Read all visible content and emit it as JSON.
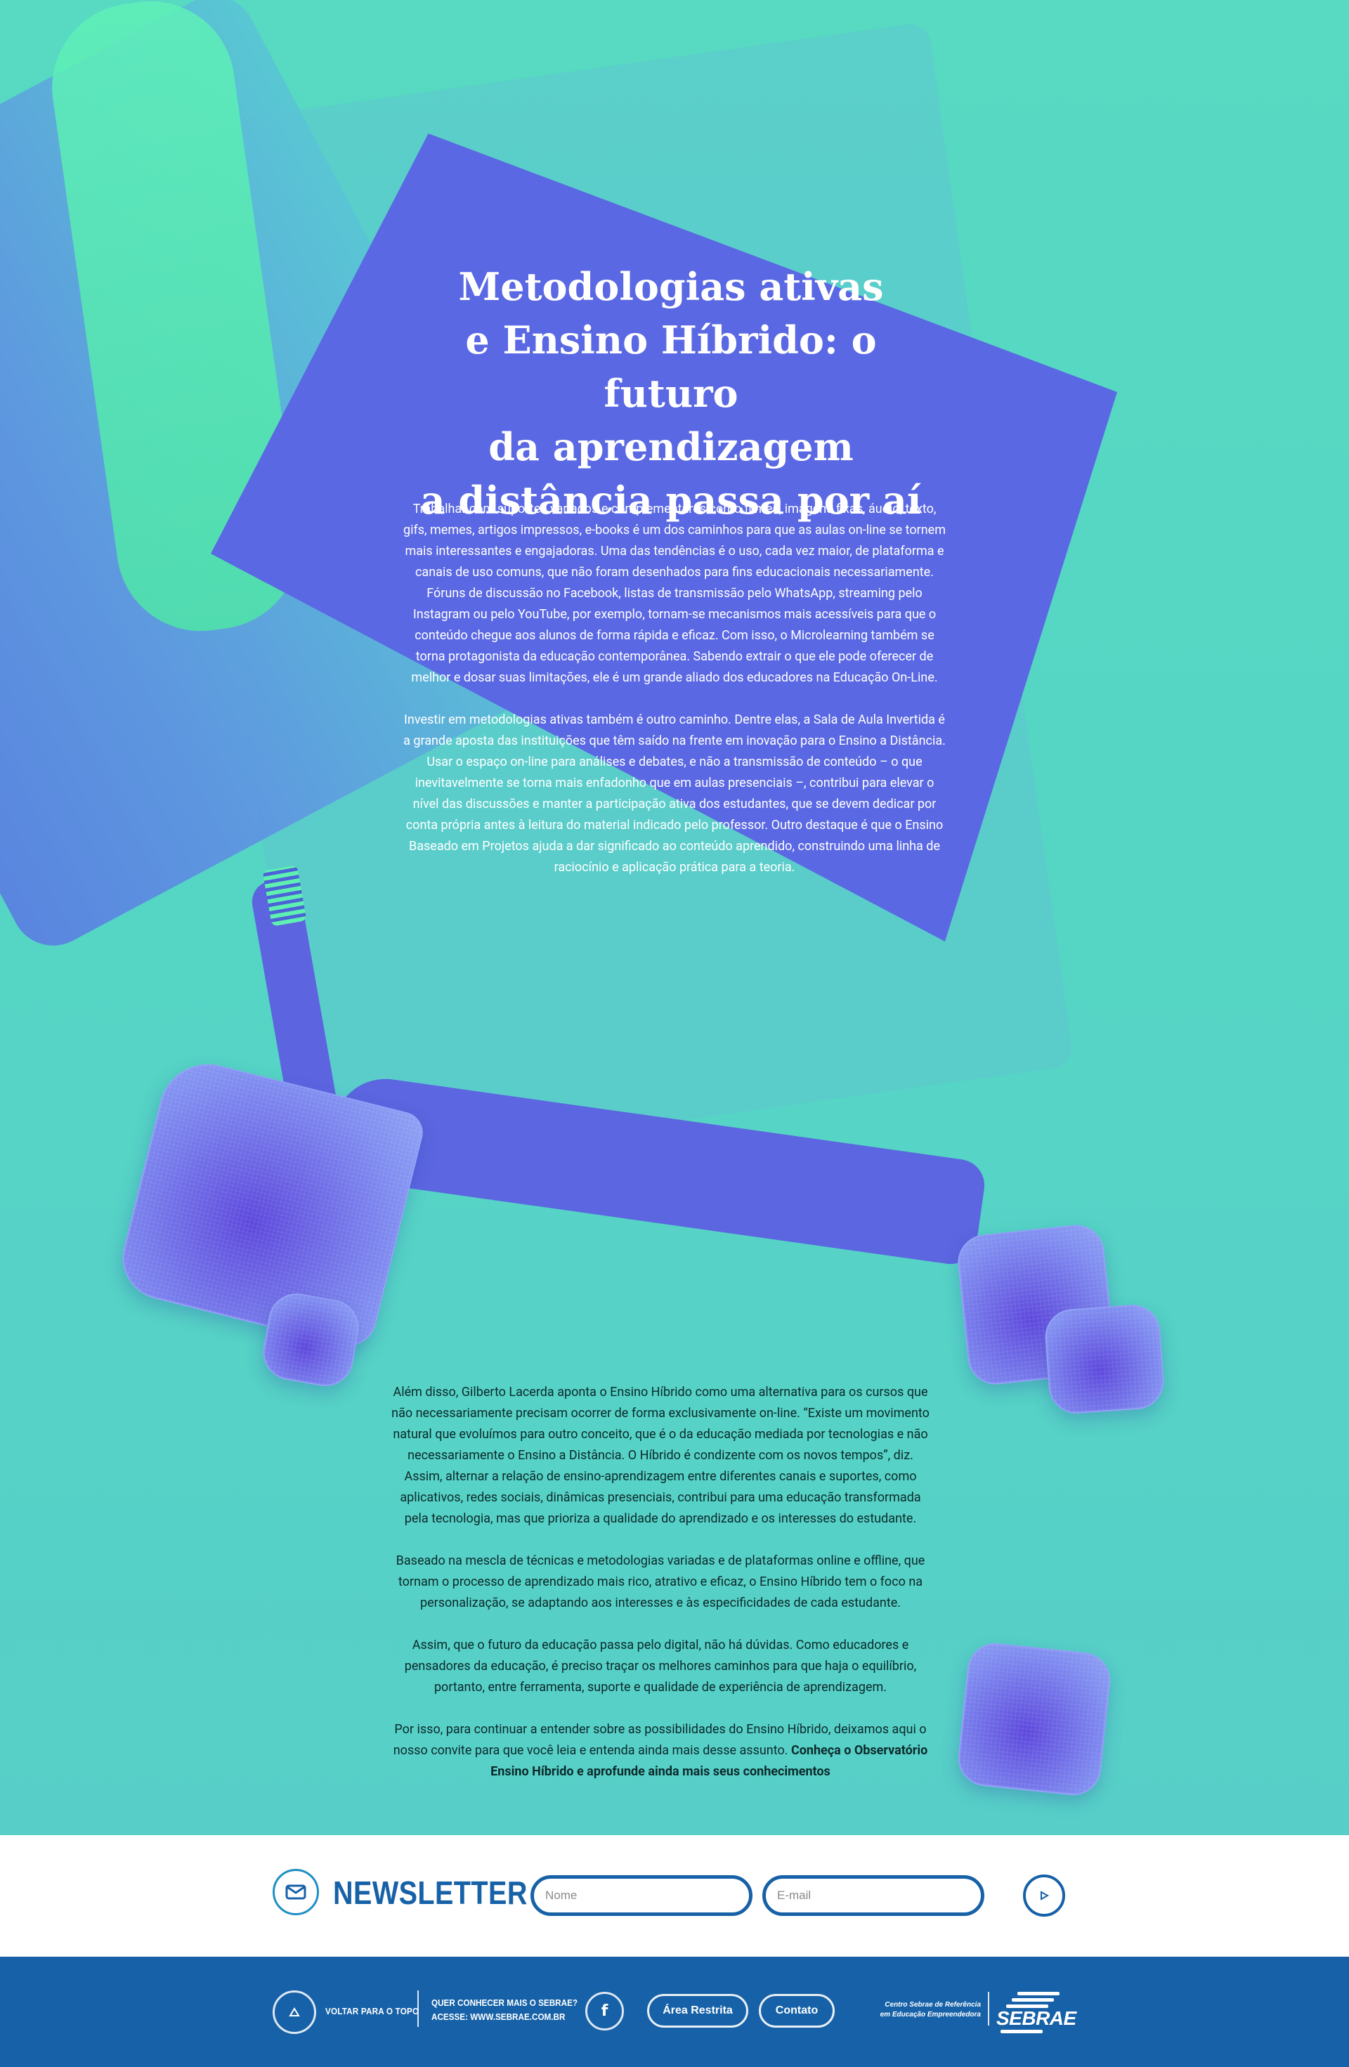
{
  "article": {
    "title": "Metodologias ativas\ne Ensino Híbrido: o futuro\nda aprendizagem\na distância passa por aí",
    "intro_paragraphs": [
      "Trabalhar com suportes variados e complementares como filmes, imagens fixas, áudio, texto, gifs, memes, artigos impressos, e-books é um dos caminhos para que as aulas on-line se tornem mais interessantes e engajadoras. Uma das tendências é o uso, cada vez maior, de plataforma e canais de uso comuns, que não foram desenhados para fins educacionais necessariamente. Fóruns de discussão no Facebook, listas de transmissão pelo WhatsApp, streaming pelo Instagram ou pelo YouTube, por exemplo, tornam-se mecanismos mais acessíveis para que o conteúdo chegue aos alunos de forma rápida e eficaz. Com isso, o Microlearning também se torna protagonista da educação contemporânea. Sabendo extrair o que ele pode oferecer de melhor e dosar suas limitações, ele é um grande aliado dos educadores na Educação On-Line.",
      "Investir em metodologias ativas também é outro caminho. Dentre elas, a Sala de Aula Invertida é a grande aposta das instituições que têm saído na frente em inovação para o Ensino a Distância. Usar o espaço on-line para análises e debates, e não a transmissão de conteúdo – o que inevitavelmente se torna mais enfadonho que em aulas presenciais –, contribui para elevar o nível das discussões e manter a participação ativa dos estudantes, que se devem dedicar por conta própria antes à leitura do material indicado pelo professor. Outro destaque é que o Ensino Baseado em Projetos ajuda a dar significado ao conteúdo aprendido, construindo uma linha de raciocínio e aplicação prática para a teoria."
    ],
    "body_paragraphs": [
      "Além disso, Gilberto Lacerda aponta o Ensino Híbrido como uma alternativa para os cursos que não necessariamente precisam ocorrer de forma exclusivamente on-line. “Existe um movimento natural que evoluímos para outro conceito, que é o da educação mediada por tecnologias e não necessariamente o Ensino a Distância. O Híbrido é condizente com os novos tempos”, diz. Assim, alternar a relação de ensino-aprendizagem entre diferentes canais e suportes, como aplicativos, redes sociais, dinâmicas presenciais, contribui para uma educação transformada pela tecnologia, mas que prioriza a qualidade do aprendizado e os interesses do estudante.",
      "Baseado na mescla de técnicas e metodologias variadas e de plataformas online e offline, que tornam o processo de aprendizado mais rico, atrativo e eficaz, o Ensino Híbrido tem o foco na personalização, se adaptando aos interesses e às especificidades de cada estudante.",
      "Assim, que o futuro da educação passa pelo digital, não há dúvidas. Como educadores e pensadores da educação, é preciso traçar os melhores caminhos para que haja o equilíbrio, portanto, entre ferramenta, suporte e qualidade de experiência de aprendizagem."
    ],
    "closing_text": "Por isso, para continuar a entender sobre as possibilidades do Ensino Híbrido, deixamos aqui o nosso convite para que você leia e entenda ainda mais desse assunto.",
    "closing_link": "Conheça o Observatório Ensino Híbrido e aprofunde ainda mais seus conhecimentos"
  },
  "newsletter": {
    "icon": "mail-icon",
    "title": "NEWSLETTER",
    "name_placeholder": "Nome",
    "email_placeholder": "E-mail",
    "submit_icon": "play-arrow-icon"
  },
  "footer": {
    "back_to_top": "VOLTAR PARA O TOPO",
    "know_more_question": "QUER CONHECER MAIS O SEBRAE?",
    "know_more_link": "ACESSE: WWW.SEBRAE.COM.BR",
    "facebook_icon": "facebook-icon",
    "facebook_glyph": "f",
    "restricted_area": "Área Restrita",
    "contact": "Contato",
    "centro_line1": "Centro Sebrae de Referência",
    "centro_line2": "em Educação Empreendedora",
    "logo_text": "SEBRAE"
  },
  "colors": {
    "hero_teal": "#56d6bf",
    "cap_blue": "#5a68e3",
    "brand_blue": "#1661a7"
  }
}
